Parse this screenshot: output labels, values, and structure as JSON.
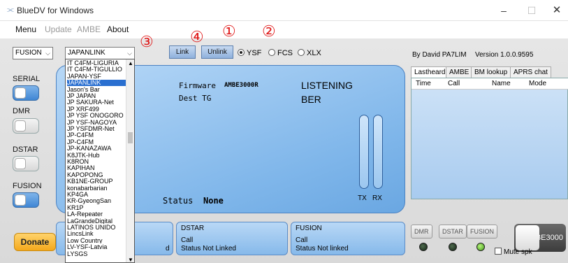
{
  "window": {
    "title": "BlueDV for Windows",
    "icon": "signal-icon",
    "min": "–",
    "max": "☐",
    "close": "✕"
  },
  "menu": {
    "items": [
      "Menu",
      "Update",
      "AMBE",
      "About"
    ]
  },
  "toolbar": {
    "mode_select": "FUSION",
    "reflector_select": "JAPANLINK",
    "link_label": "Link",
    "unlink_label": "Unlink",
    "radios": [
      {
        "label": "YSF",
        "checked": true
      },
      {
        "label": "FCS",
        "checked": false
      },
      {
        "label": "XLX",
        "checked": false
      }
    ]
  },
  "annotations": {
    "a1": "①",
    "a2": "②",
    "a3": "③",
    "a4": "④"
  },
  "side": {
    "serial": "SERIAL",
    "dmr": "DMR",
    "dstar": "DSTAR",
    "fusion": "FUSION",
    "donate": "Donate"
  },
  "display": {
    "firmware_label": "Firmware",
    "firmware_value": "AMBE3000R",
    "dest_label": "Dest TG",
    "listening": "LISTENING",
    "ber": "BER",
    "status_label": "Status",
    "status_value": "None",
    "tx": "TX",
    "rx": "RX"
  },
  "right": {
    "byline": "By David PA7LIM",
    "version": "Version 1.0.0.9595",
    "tabs": [
      "Lastheard",
      "AMBE",
      "BM lookup",
      "APRS chat"
    ],
    "columns": [
      "Time",
      "Call",
      "Name",
      "Mode"
    ],
    "led_labels": [
      "DMR",
      "DSTAR",
      "FUSION"
    ],
    "ambe_button": "AMBE3000",
    "mute": "Mute spk"
  },
  "modes": [
    {
      "header": "",
      "call": "",
      "status": "d"
    },
    {
      "header": "DSTAR",
      "call": "Call",
      "status": "Status  Not Linked"
    },
    {
      "header": "FUSION",
      "call": "Call",
      "status": "Status  Not linked"
    }
  ],
  "dropdown": {
    "items": [
      "IT C4FM-LIGURIA",
      "IT C4FM-TIGULLIO",
      "JAPAN-YSF",
      "JAPANLINK",
      "Jason's Bar",
      "JP JAPAN",
      "JP SAKURA-Net",
      "JP XRF499",
      "JP YSF ONOGORO",
      "JP YSF-NAGOYA",
      "JP YSFDMR-Net",
      "JP-C4FM",
      "JP-C4FM",
      "JP-KANAZAWA",
      "K8JTK-Hub",
      "K8RON",
      "KAPIHAN",
      "KAPOPONG",
      "KB1NE-GROUP",
      "konabarbarian",
      "KP4GA",
      "KR-GyeongSan",
      "KR1P",
      "LA-Repeater",
      "LaGrandeDigital",
      "LATINOS UNIDO",
      "LincsLink",
      "Low Country",
      "LV-YSF-Latvia",
      "LYSGS"
    ],
    "selected_index": 3
  }
}
